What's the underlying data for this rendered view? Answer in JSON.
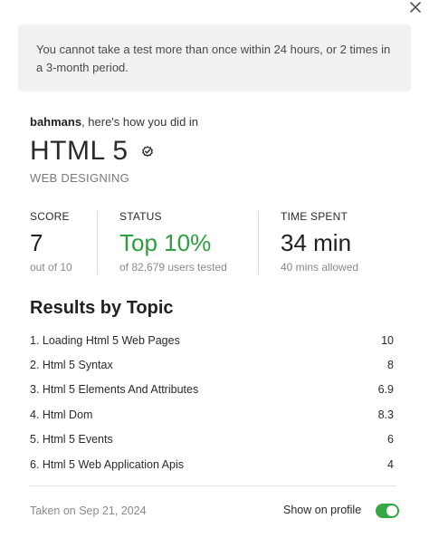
{
  "notice": {
    "text": "You cannot take a test more than once within 24 hours, or 2 times in a 3-month period."
  },
  "greeting": {
    "username": "bahmans",
    "suffix": ", here's how you did in"
  },
  "test": {
    "title": "HTML 5",
    "category": "WEB DESIGNING"
  },
  "stats": {
    "score": {
      "label": "SCORE",
      "value": "7",
      "sub": "out of 10"
    },
    "status": {
      "label": "STATUS",
      "value": "Top 10%",
      "sub": "of 82,679 users tested"
    },
    "time": {
      "label": "TIME SPENT",
      "value": "34 min",
      "sub": "40 mins allowed"
    }
  },
  "results": {
    "title": "Results by Topic",
    "topics": [
      {
        "name": "1. Loading Html 5 Web Pages",
        "score": "10"
      },
      {
        "name": "2. Html 5 Syntax",
        "score": "8"
      },
      {
        "name": "3. Html 5 Elements And Attributes",
        "score": "6.9"
      },
      {
        "name": "4. Html Dom",
        "score": "8.3"
      },
      {
        "name": "5. Html 5 Events",
        "score": "6"
      },
      {
        "name": "6. Html 5 Web Application Apis",
        "score": "4"
      }
    ]
  },
  "footer": {
    "taken": "Taken on Sep 21, 2024",
    "show_on_profile": "Show on profile",
    "show_on_profile_enabled": true
  },
  "colors": {
    "accent_green": "#2e9e3e",
    "toggle_on": "#35a843",
    "notice_bg": "#f1f1f1"
  },
  "icons": {
    "close": "close-icon",
    "verified": "verified-check-icon"
  }
}
